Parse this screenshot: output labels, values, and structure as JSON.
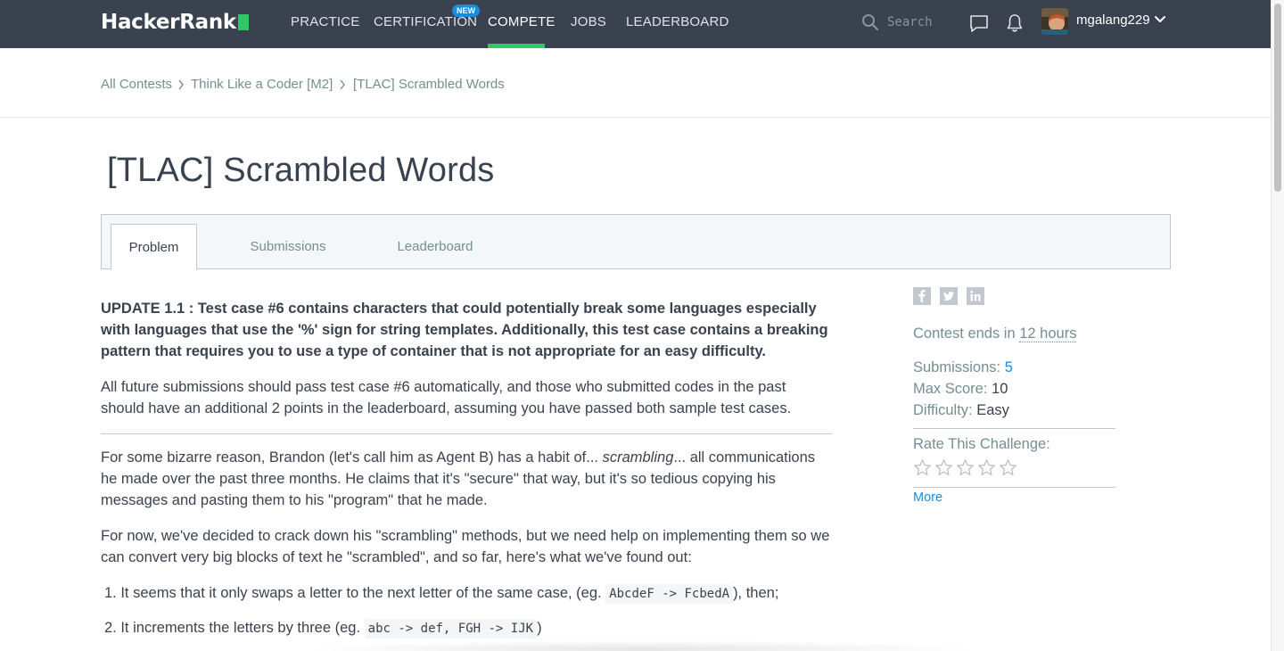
{
  "nav": {
    "logo_text": "HackerRank",
    "items": [
      "PRACTICE",
      "CERTIFICATION",
      "COMPETE",
      "JOBS",
      "LEADERBOARD"
    ],
    "active_item": "COMPETE",
    "new_badge": "NEW",
    "search_placeholder": "Search",
    "username": "mgalang229"
  },
  "breadcrumb": [
    "All Contests",
    "Think Like a Coder [M2]",
    "[TLAC] Scrambled Words"
  ],
  "title": "[TLAC] Scrambled Words",
  "tabs": [
    "Problem",
    "Submissions",
    "Leaderboard"
  ],
  "active_tab": "Problem",
  "problem": {
    "update": "UPDATE 1.1 : Test case #6 contains characters that could potentially break some languages especially with languages that use the '%' sign for string templates. Additionally, this test case contains a breaking pattern that requires you to use a type of container that is not appropriate for an easy difficulty.",
    "future": "All future submissions should pass test case #6 automatically, and those who submitted codes in the past should have an additional 2 points in the leaderboard, assuming you have passed both sample test cases.",
    "intro_a": "For some bizarre reason, Brandon (let's call him as Agent B) has a habit of... ",
    "intro_em": "scrambling",
    "intro_b": "... all communications he made over the past three months. He claims that it's \"secure\" that way, but it's so tedious copying his messages and pasting them to his \"program\" that he made.",
    "crack": "For now, we've decided to crack down his \"scrambling\" methods, but we need help on implementing them so we can convert very big blocks of text he \"scrambled\", and so far, here's what we've found out:",
    "list": [
      {
        "num": "1.",
        "before": " It seems that it only swaps a letter to the next letter of the same case, (eg. ",
        "code": "AbcdeF -> FcbedA",
        "after": "), then;"
      },
      {
        "num": "2.",
        "before": " It increments the letters by three (eg. ",
        "code": "abc -> def, FGH -> IJK",
        "after": ")"
      }
    ]
  },
  "sidebar": {
    "contest_ends_label": "Contest ends in ",
    "contest_ends_value": "12 hours",
    "submissions_label": "Submissions: ",
    "submissions_value": "5",
    "max_score_label": "Max Score: ",
    "max_score_value": "10",
    "difficulty_label": "Difficulty: ",
    "difficulty_value": "Easy",
    "rate_label": "Rate This Challenge:",
    "rating": 0,
    "more": "More"
  },
  "colors": {
    "nav_bg": "#39424e",
    "brand_green": "#2ec866",
    "link_blue": "#1a8cde",
    "muted_text": "#738f93"
  }
}
